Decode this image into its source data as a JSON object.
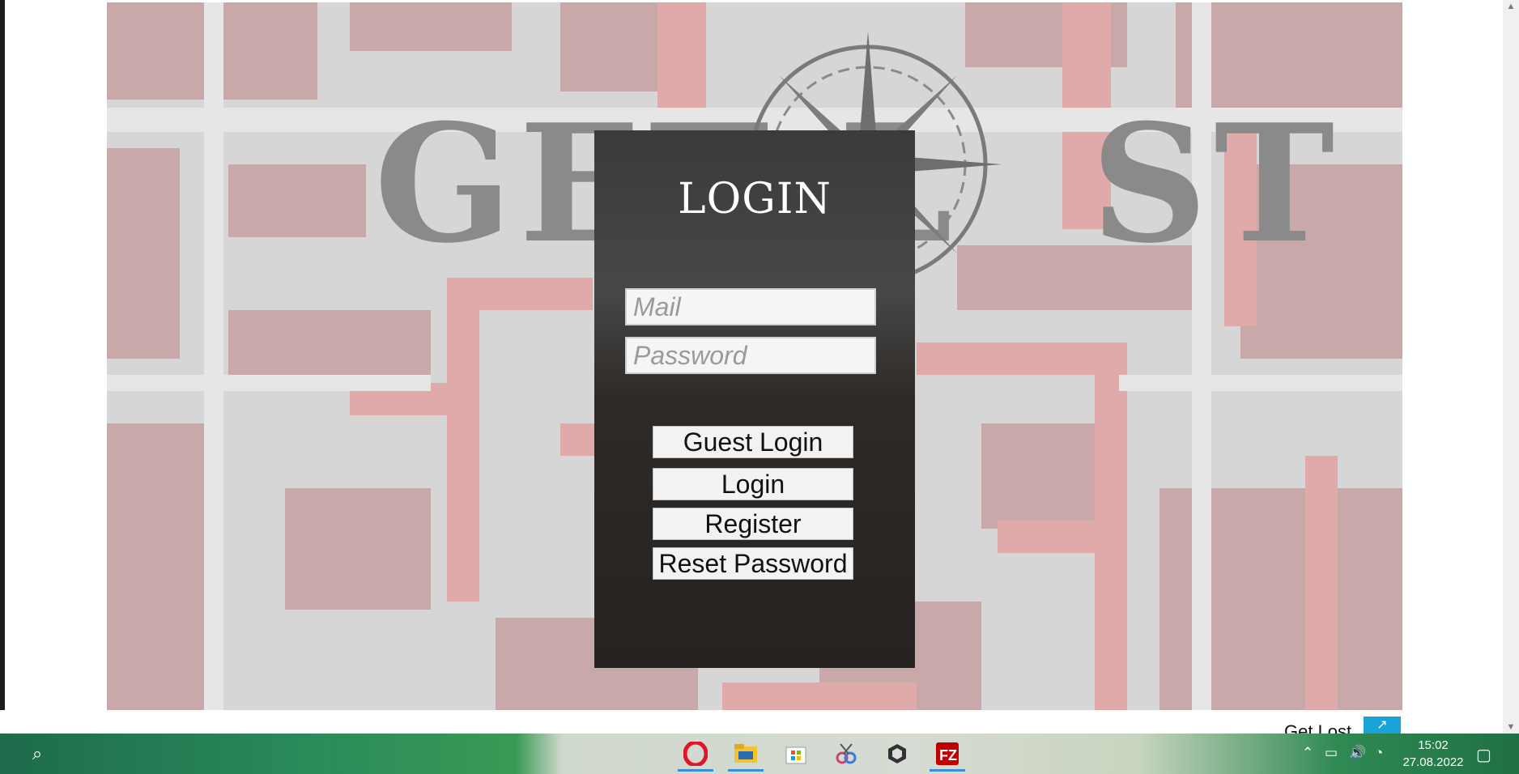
{
  "app": {
    "game_title_left": "GET L",
    "game_title_right": "ST",
    "login_title": "LOGIN"
  },
  "form": {
    "mail_placeholder": "Mail",
    "password_placeholder": "Password",
    "guest_login_label": "Guest Login",
    "login_label": "Login",
    "register_label": "Register",
    "reset_password_label": "Reset Password"
  },
  "page_footer": {
    "title": "Get Lost",
    "expand_icon": "expand-icon"
  },
  "taskbar": {
    "apps": [
      "search-icon",
      "opera-icon",
      "file-explorer-icon",
      "microsoft-store-icon",
      "snipping-tool-icon",
      "unity-icon",
      "filezilla-icon"
    ],
    "time": "15:02",
    "date": "27.08.2022"
  },
  "colors": {
    "maze_red": "#d9a3a3",
    "panel_dark": "#262220",
    "accent_blue": "#1aa3d9"
  }
}
